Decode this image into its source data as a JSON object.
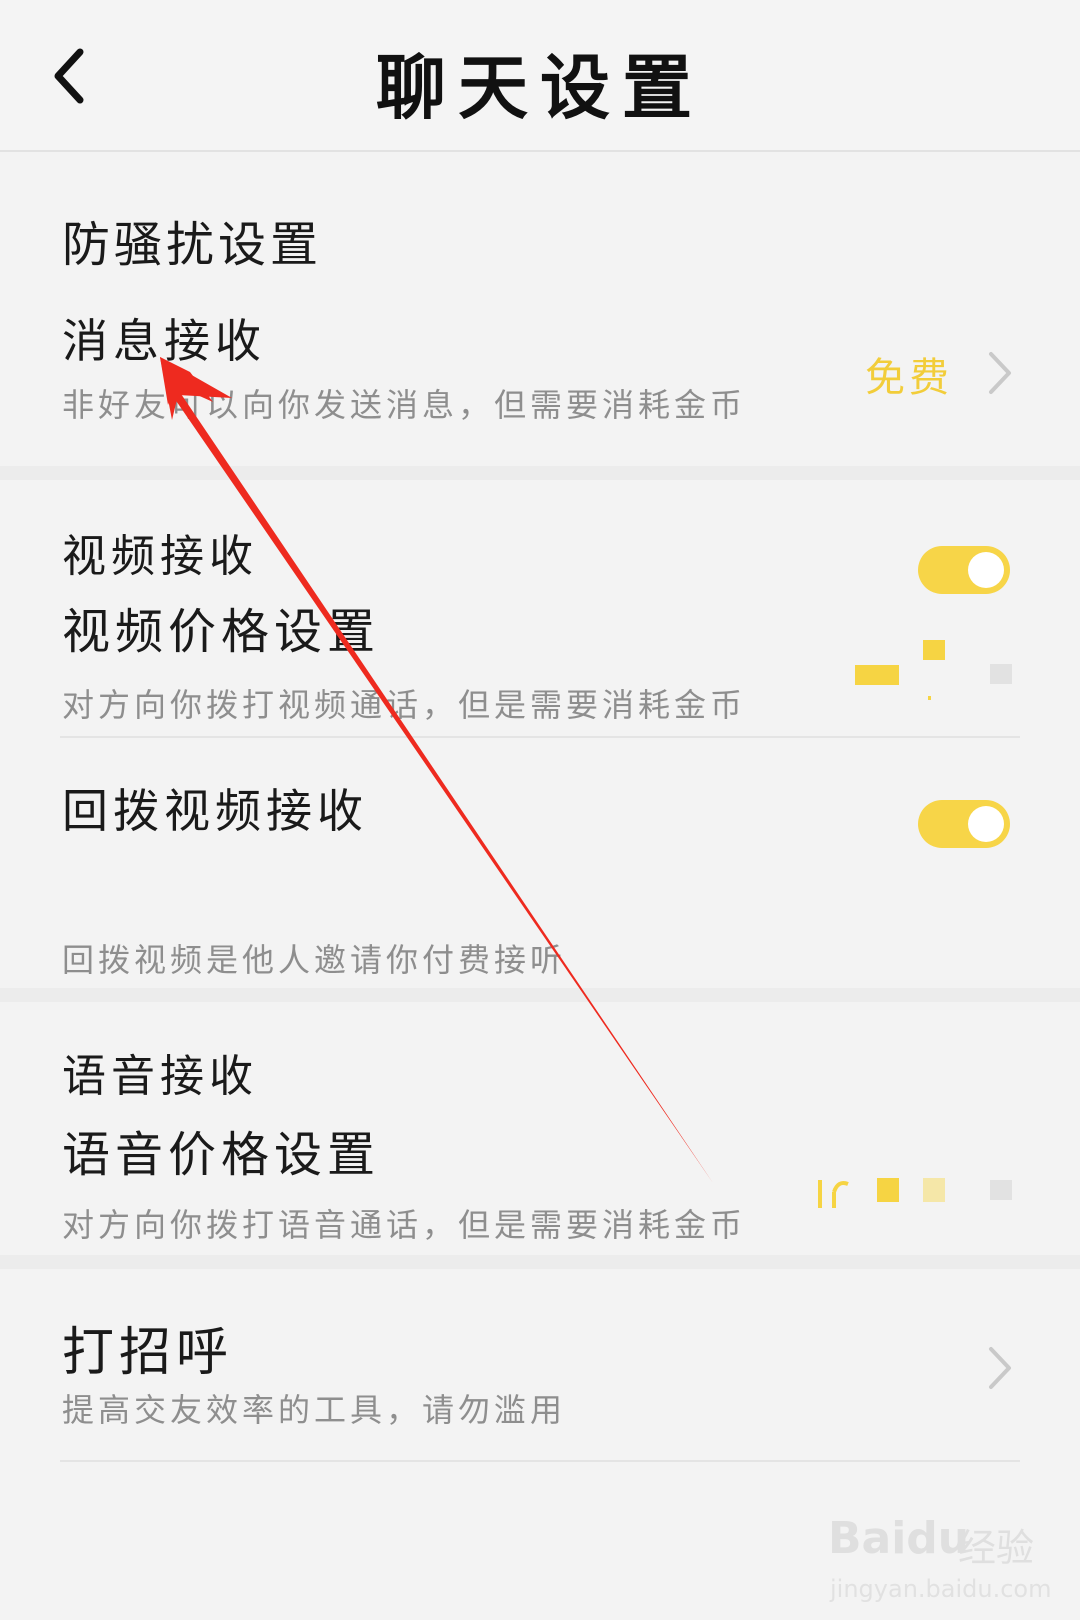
{
  "header": {
    "title": "聊天设置"
  },
  "sections": {
    "harassment": {
      "title": "防骚扰设置",
      "message_receive": {
        "title": "消息接收",
        "subtitle": "非好友可以向你发送消息，但需要消耗金币",
        "value": "免费"
      }
    },
    "video": {
      "receive_label": "视频接收",
      "receive_enabled": true,
      "price_title": "视频价格设置",
      "price_subtitle": "对方向你拨打视频通话，但是需要消耗金币",
      "callback_title": "回拨视频接收",
      "callback_enabled": true,
      "callback_subtitle": "回拨视频是他人邀请你付费接听"
    },
    "voice": {
      "receive_label": "语音接收",
      "price_title": "语音价格设置",
      "price_subtitle": "对方向你拨打语音通话，但是需要消耗金币"
    },
    "greet": {
      "title": "打招呼",
      "subtitle": "提高交友效率的工具，请勿滥用"
    }
  },
  "watermark": {
    "brand": "Baidu",
    "brand_cn": "经验",
    "url": "jingyan.baidu.com"
  },
  "colors": {
    "accent_yellow": "#f7d548",
    "annotation_arrow": "#ee2a1f"
  },
  "icons": {
    "back": "chevron-left-icon",
    "row_arrow": "chevron-right-icon"
  }
}
